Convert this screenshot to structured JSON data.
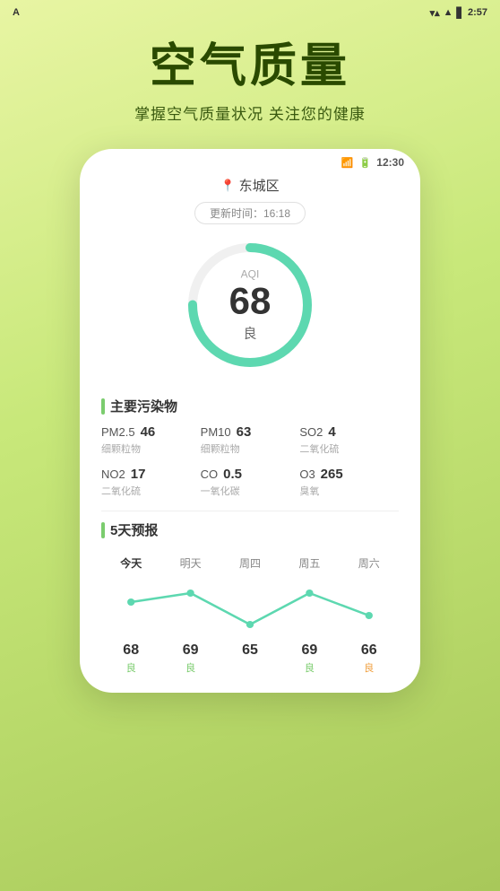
{
  "statusBar": {
    "appLabel": "A",
    "wifiIcon": "▼",
    "batteryIcon": "🔋",
    "batteryText": "⬛",
    "time": "2:57"
  },
  "hero": {
    "title": "空气质量",
    "subtitle": "掌握空气质量状况 关注您的健康"
  },
  "phone": {
    "statusTime": "12:30",
    "location": "东城区",
    "updateLabel": "更新时间：",
    "updateTime": "16:18",
    "aqi": {
      "label": "AQI",
      "value": "68",
      "quality": "良"
    },
    "pollutants": {
      "sectionTitle": "主要污染物",
      "items": [
        {
          "name": "PM2.5",
          "value": "46",
          "desc": "细颗粒物"
        },
        {
          "name": "PM10",
          "value": "63",
          "desc": "细颗粒物"
        },
        {
          "name": "SO2",
          "value": "4",
          "desc": "二氧化硫"
        },
        {
          "name": "NO2",
          "value": "17",
          "desc": "二氧化硫"
        },
        {
          "name": "CO",
          "value": "0.5",
          "desc": "一氧化碳"
        },
        {
          "name": "O3",
          "value": "265",
          "desc": "臭氧"
        }
      ]
    },
    "forecast": {
      "sectionTitle": "5天预报",
      "days": [
        {
          "label": "今天",
          "value": "68",
          "quality": "良",
          "qualityClass": "good"
        },
        {
          "label": "明天",
          "value": "69",
          "quality": "良",
          "qualityClass": "good"
        },
        {
          "label": "周四",
          "value": "65",
          "quality": "",
          "qualityClass": ""
        },
        {
          "label": "周五",
          "value": "69",
          "quality": "良",
          "qualityClass": "good"
        },
        {
          "label": "周六",
          "value": "66",
          "quality": "",
          "qualityClass": "bad"
        }
      ]
    }
  }
}
